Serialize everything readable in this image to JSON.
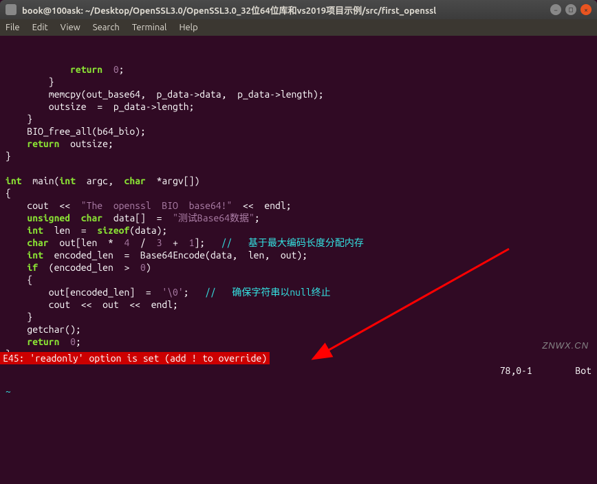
{
  "window": {
    "title": "book@100ask: ~/Desktop/OpenSSL3.0/OpenSSL3.0_32位64位库和vs2019项目示例/src/first_openssl"
  },
  "menubar": {
    "items": [
      "File",
      "Edit",
      "View",
      "Search",
      "Terminal",
      "Help"
    ]
  },
  "code": {
    "lines": [
      {
        "indent": "            ",
        "tokens": [
          {
            "t": "return",
            "c": "keyword"
          },
          {
            "t": "  ",
            "c": "sp"
          },
          {
            "t": "0",
            "c": "number"
          },
          {
            "t": ";",
            "c": "punct"
          }
        ]
      },
      {
        "indent": "        ",
        "tokens": [
          {
            "t": "}",
            "c": "punct"
          }
        ]
      },
      {
        "indent": "        ",
        "tokens": [
          {
            "t": "memcpy(out_base64,  p_data->data,  p_data->length);",
            "c": "ident"
          }
        ]
      },
      {
        "indent": "        ",
        "tokens": [
          {
            "t": "outsize  =  p_data->length;",
            "c": "ident"
          }
        ]
      },
      {
        "indent": "    ",
        "tokens": [
          {
            "t": "}",
            "c": "punct"
          }
        ]
      },
      {
        "indent": "    ",
        "tokens": [
          {
            "t": "BIO_free_all(b64_bio);",
            "c": "ident"
          }
        ]
      },
      {
        "indent": "    ",
        "tokens": [
          {
            "t": "return",
            "c": "keyword"
          },
          {
            "t": "  outsize;",
            "c": "ident"
          }
        ]
      },
      {
        "indent": "",
        "tokens": [
          {
            "t": "}",
            "c": "punct"
          }
        ]
      },
      {
        "indent": "",
        "tokens": []
      },
      {
        "indent": "",
        "tokens": [
          {
            "t": "int",
            "c": "type"
          },
          {
            "t": "  main(",
            "c": "ident"
          },
          {
            "t": "int",
            "c": "type"
          },
          {
            "t": "  argc,  ",
            "c": "ident"
          },
          {
            "t": "char",
            "c": "type"
          },
          {
            "t": "  *argv[])",
            "c": "ident"
          }
        ]
      },
      {
        "indent": "",
        "tokens": [
          {
            "t": "{",
            "c": "punct"
          }
        ]
      },
      {
        "indent": "    ",
        "tokens": [
          {
            "t": "cout  <<  ",
            "c": "ident"
          },
          {
            "t": "\"The  openssl  BIO  base64!\"",
            "c": "string"
          },
          {
            "t": "  <<  endl;",
            "c": "ident"
          }
        ]
      },
      {
        "indent": "    ",
        "tokens": [
          {
            "t": "unsigned",
            "c": "type"
          },
          {
            "t": "  ",
            "c": "sp"
          },
          {
            "t": "char",
            "c": "type"
          },
          {
            "t": "  data[]  =  ",
            "c": "ident"
          },
          {
            "t": "\"测试Base64数据\"",
            "c": "string"
          },
          {
            "t": ";",
            "c": "punct"
          }
        ]
      },
      {
        "indent": "    ",
        "tokens": [
          {
            "t": "int",
            "c": "type"
          },
          {
            "t": "  len  =  ",
            "c": "ident"
          },
          {
            "t": "sizeof",
            "c": "keyword"
          },
          {
            "t": "(data);",
            "c": "ident"
          }
        ]
      },
      {
        "indent": "    ",
        "tokens": [
          {
            "t": "char",
            "c": "type"
          },
          {
            "t": "  out[len  *  ",
            "c": "ident"
          },
          {
            "t": "4",
            "c": "number"
          },
          {
            "t": "  /  ",
            "c": "ident"
          },
          {
            "t": "3",
            "c": "number"
          },
          {
            "t": "  +  ",
            "c": "ident"
          },
          {
            "t": "1",
            "c": "number"
          },
          {
            "t": "];   ",
            "c": "ident"
          },
          {
            "t": "//   基于最大编码长度分配内存",
            "c": "comment"
          }
        ]
      },
      {
        "indent": "    ",
        "tokens": [
          {
            "t": "int",
            "c": "type"
          },
          {
            "t": "  encoded_len  =  Base64Encode(data,  len,  out);",
            "c": "ident"
          }
        ]
      },
      {
        "indent": "    ",
        "tokens": [
          {
            "t": "if",
            "c": "keyword"
          },
          {
            "t": "  (encoded_len  >  ",
            "c": "ident"
          },
          {
            "t": "0",
            "c": "number"
          },
          {
            "t": ")",
            "c": "ident"
          }
        ]
      },
      {
        "indent": "    ",
        "tokens": [
          {
            "t": "{",
            "c": "punct"
          }
        ]
      },
      {
        "indent": "        ",
        "tokens": [
          {
            "t": "out[encoded_len]  =  ",
            "c": "ident"
          },
          {
            "t": "'\\0'",
            "c": "string"
          },
          {
            "t": ";   ",
            "c": "ident"
          },
          {
            "t": "//   确保字符串以null终止",
            "c": "comment"
          }
        ]
      },
      {
        "indent": "        ",
        "tokens": [
          {
            "t": "cout  <<  out  <<  endl;",
            "c": "ident"
          }
        ]
      },
      {
        "indent": "    ",
        "tokens": [
          {
            "t": "}",
            "c": "punct"
          }
        ]
      },
      {
        "indent": "    ",
        "tokens": [
          {
            "t": "getchar();",
            "c": "ident"
          }
        ]
      },
      {
        "indent": "    ",
        "tokens": [
          {
            "t": "return",
            "c": "keyword"
          },
          {
            "t": "  ",
            "c": "sp"
          },
          {
            "t": "0",
            "c": "number"
          },
          {
            "t": ";",
            "c": "punct"
          }
        ]
      },
      {
        "indent": "",
        "tokens": [
          {
            "t": "}",
            "c": "punct"
          }
        ]
      }
    ],
    "tilde": "~"
  },
  "status": {
    "error": "E45: 'readonly' option is set (add ! to override)",
    "position": "78,0-1",
    "location": "Bot"
  },
  "watermark": "ZNWX.CN"
}
